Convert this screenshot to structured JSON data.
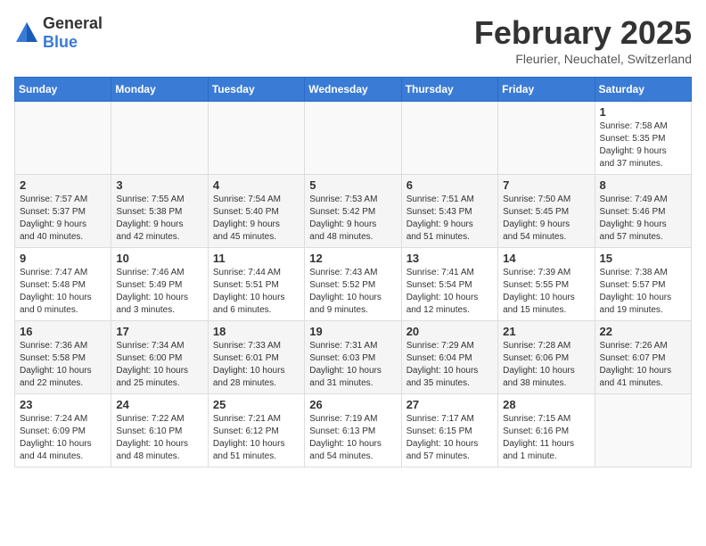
{
  "header": {
    "logo_general": "General",
    "logo_blue": "Blue",
    "month_title": "February 2025",
    "location": "Fleurier, Neuchatel, Switzerland"
  },
  "days_of_week": [
    "Sunday",
    "Monday",
    "Tuesday",
    "Wednesday",
    "Thursday",
    "Friday",
    "Saturday"
  ],
  "weeks": [
    [
      {
        "day": "",
        "info": ""
      },
      {
        "day": "",
        "info": ""
      },
      {
        "day": "",
        "info": ""
      },
      {
        "day": "",
        "info": ""
      },
      {
        "day": "",
        "info": ""
      },
      {
        "day": "",
        "info": ""
      },
      {
        "day": "1",
        "info": "Sunrise: 7:58 AM\nSunset: 5:35 PM\nDaylight: 9 hours\nand 37 minutes."
      }
    ],
    [
      {
        "day": "2",
        "info": "Sunrise: 7:57 AM\nSunset: 5:37 PM\nDaylight: 9 hours\nand 40 minutes."
      },
      {
        "day": "3",
        "info": "Sunrise: 7:55 AM\nSunset: 5:38 PM\nDaylight: 9 hours\nand 42 minutes."
      },
      {
        "day": "4",
        "info": "Sunrise: 7:54 AM\nSunset: 5:40 PM\nDaylight: 9 hours\nand 45 minutes."
      },
      {
        "day": "5",
        "info": "Sunrise: 7:53 AM\nSunset: 5:42 PM\nDaylight: 9 hours\nand 48 minutes."
      },
      {
        "day": "6",
        "info": "Sunrise: 7:51 AM\nSunset: 5:43 PM\nDaylight: 9 hours\nand 51 minutes."
      },
      {
        "day": "7",
        "info": "Sunrise: 7:50 AM\nSunset: 5:45 PM\nDaylight: 9 hours\nand 54 minutes."
      },
      {
        "day": "8",
        "info": "Sunrise: 7:49 AM\nSunset: 5:46 PM\nDaylight: 9 hours\nand 57 minutes."
      }
    ],
    [
      {
        "day": "9",
        "info": "Sunrise: 7:47 AM\nSunset: 5:48 PM\nDaylight: 10 hours\nand 0 minutes."
      },
      {
        "day": "10",
        "info": "Sunrise: 7:46 AM\nSunset: 5:49 PM\nDaylight: 10 hours\nand 3 minutes."
      },
      {
        "day": "11",
        "info": "Sunrise: 7:44 AM\nSunset: 5:51 PM\nDaylight: 10 hours\nand 6 minutes."
      },
      {
        "day": "12",
        "info": "Sunrise: 7:43 AM\nSunset: 5:52 PM\nDaylight: 10 hours\nand 9 minutes."
      },
      {
        "day": "13",
        "info": "Sunrise: 7:41 AM\nSunset: 5:54 PM\nDaylight: 10 hours\nand 12 minutes."
      },
      {
        "day": "14",
        "info": "Sunrise: 7:39 AM\nSunset: 5:55 PM\nDaylight: 10 hours\nand 15 minutes."
      },
      {
        "day": "15",
        "info": "Sunrise: 7:38 AM\nSunset: 5:57 PM\nDaylight: 10 hours\nand 19 minutes."
      }
    ],
    [
      {
        "day": "16",
        "info": "Sunrise: 7:36 AM\nSunset: 5:58 PM\nDaylight: 10 hours\nand 22 minutes."
      },
      {
        "day": "17",
        "info": "Sunrise: 7:34 AM\nSunset: 6:00 PM\nDaylight: 10 hours\nand 25 minutes."
      },
      {
        "day": "18",
        "info": "Sunrise: 7:33 AM\nSunset: 6:01 PM\nDaylight: 10 hours\nand 28 minutes."
      },
      {
        "day": "19",
        "info": "Sunrise: 7:31 AM\nSunset: 6:03 PM\nDaylight: 10 hours\nand 31 minutes."
      },
      {
        "day": "20",
        "info": "Sunrise: 7:29 AM\nSunset: 6:04 PM\nDaylight: 10 hours\nand 35 minutes."
      },
      {
        "day": "21",
        "info": "Sunrise: 7:28 AM\nSunset: 6:06 PM\nDaylight: 10 hours\nand 38 minutes."
      },
      {
        "day": "22",
        "info": "Sunrise: 7:26 AM\nSunset: 6:07 PM\nDaylight: 10 hours\nand 41 minutes."
      }
    ],
    [
      {
        "day": "23",
        "info": "Sunrise: 7:24 AM\nSunset: 6:09 PM\nDaylight: 10 hours\nand 44 minutes."
      },
      {
        "day": "24",
        "info": "Sunrise: 7:22 AM\nSunset: 6:10 PM\nDaylight: 10 hours\nand 48 minutes."
      },
      {
        "day": "25",
        "info": "Sunrise: 7:21 AM\nSunset: 6:12 PM\nDaylight: 10 hours\nand 51 minutes."
      },
      {
        "day": "26",
        "info": "Sunrise: 7:19 AM\nSunset: 6:13 PM\nDaylight: 10 hours\nand 54 minutes."
      },
      {
        "day": "27",
        "info": "Sunrise: 7:17 AM\nSunset: 6:15 PM\nDaylight: 10 hours\nand 57 minutes."
      },
      {
        "day": "28",
        "info": "Sunrise: 7:15 AM\nSunset: 6:16 PM\nDaylight: 11 hours\nand 1 minute."
      },
      {
        "day": "",
        "info": ""
      }
    ]
  ]
}
